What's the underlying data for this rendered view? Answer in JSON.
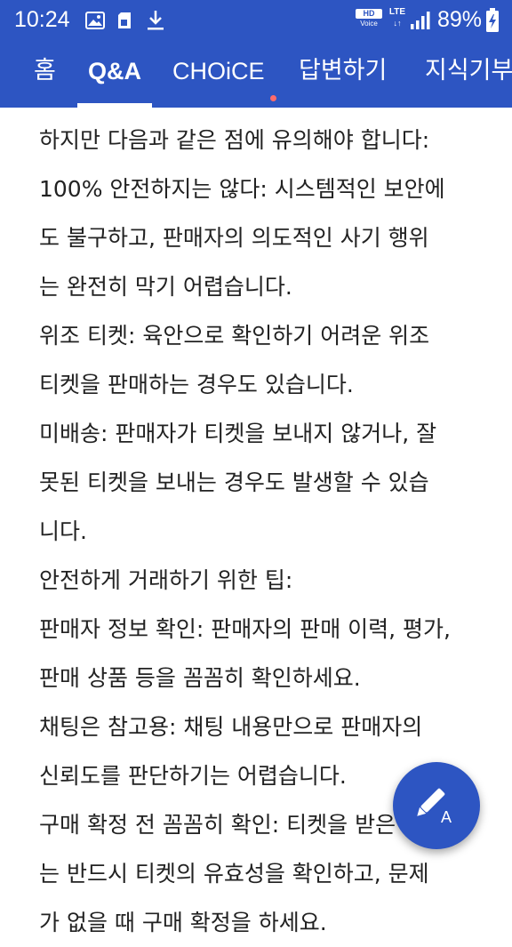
{
  "status_bar": {
    "time": "10:24",
    "hd_label": "HD",
    "voice_label": "Voice",
    "network_label": "LTE",
    "battery": "89%",
    "icons": [
      "image-icon",
      "sim-icon",
      "download-icon",
      "signal-icon",
      "battery-charging-icon"
    ]
  },
  "tabs": [
    {
      "label": "홈"
    },
    {
      "label": "Q&A"
    },
    {
      "label": "CHOiCE"
    },
    {
      "label": "답변하기"
    },
    {
      "label": "지식기부"
    }
  ],
  "active_tab": "Q&A",
  "colors": {
    "header": "#2d55c2",
    "new_dot": "#ff6b6b",
    "text": "#222222"
  },
  "content": {
    "lines": [
      "하지만 다음과 같은 점에 유의해야 합니다:",
      "100% 안전하지는 않다: 시스템적인 보안에",
      "도 불구하고, 판매자의 의도적인 사기 행위",
      "는 완전히 막기 어렵습니다.",
      "위조 티켓: 육안으로 확인하기 어려운 위조",
      "티켓을 판매하는 경우도 있습니다.",
      "미배송: 판매자가 티켓을 보내지 않거나, 잘",
      "못된 티켓을 보내는 경우도 발생할 수 있습",
      "니다.",
      "안전하게 거래하기 위한 팁:",
      "판매자 정보 확인: 판매자의 판매 이력, 평가,",
      "판매 상품 등을 꼼꼼히 확인하세요.",
      "채팅은 참고용: 채팅 내용만으로 판매자의",
      "신뢰도를 판단하기는 어렵습니다.",
      "구매 확정 전 꼼꼼히 확인: 티켓을 받은 후에",
      "는 반드시 티켓의 유효성을 확인하고, 문제",
      "가 없을 때 구매 확정을 하세요."
    ]
  },
  "fab": {
    "icon": "write-answer-icon",
    "letter": "A"
  }
}
